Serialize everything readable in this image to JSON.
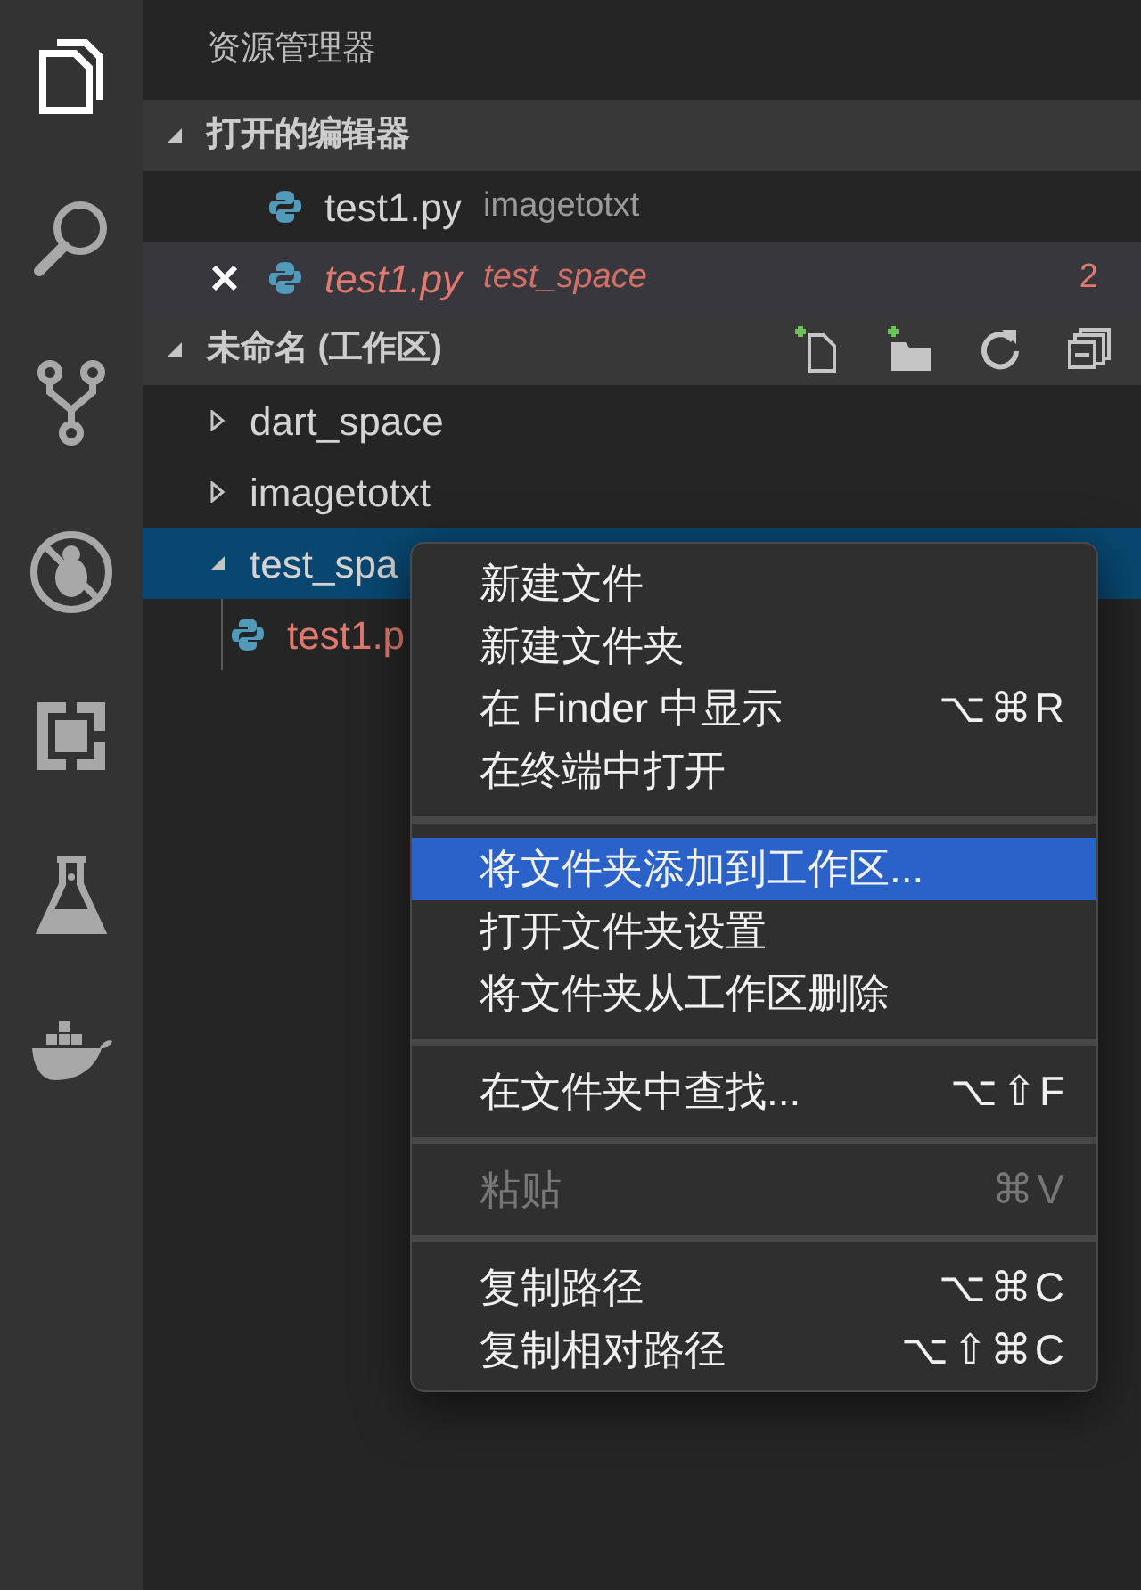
{
  "activity_bar": [
    {
      "kind": "files",
      "selected": true
    },
    {
      "kind": "search",
      "selected": false
    },
    {
      "kind": "scm",
      "selected": false
    },
    {
      "kind": "debug",
      "selected": false
    },
    {
      "kind": "extensions",
      "selected": false
    },
    {
      "kind": "flask",
      "selected": false
    },
    {
      "kind": "docker",
      "selected": false
    }
  ],
  "sidebar": {
    "title": "资源管理器",
    "open_editors": {
      "title": "打开的编辑器",
      "expanded": true,
      "items": [
        {
          "name": "test1.py",
          "folder": "imagetotxt",
          "focused": false,
          "preview": false,
          "has_errors": false
        },
        {
          "name": "test1.py",
          "folder": "test_space",
          "focused": true,
          "preview": true,
          "has_errors": true,
          "problems": "2"
        }
      ]
    },
    "workspace": {
      "title": "未命名 (工作区)",
      "expanded": true,
      "tree": [
        {
          "name": "dart_space",
          "kind": "folder",
          "expanded": false,
          "selected": false
        },
        {
          "name": "imagetotxt",
          "kind": "folder",
          "expanded": false,
          "selected": false
        },
        {
          "name": "test_spa",
          "kind": "folder",
          "expanded": true,
          "selected": true,
          "children": [
            {
              "name": "test1.p",
              "kind": "file",
              "has_errors": true,
              "selected": false
            }
          ]
        }
      ]
    }
  },
  "context_menu": {
    "groups": [
      [
        {
          "label": "新建文件",
          "selected": false,
          "disabled": false
        },
        {
          "label": "新建文件夹",
          "selected": false,
          "disabled": false
        },
        {
          "label": "在 Finder 中显示",
          "shortcut": "⌥⌘R",
          "selected": false,
          "disabled": false
        },
        {
          "label": "在终端中打开",
          "selected": false,
          "disabled": false
        }
      ],
      [
        {
          "label": "将文件夹添加到工作区...",
          "selected": true,
          "disabled": false
        },
        {
          "label": "打开文件夹设置",
          "selected": false,
          "disabled": false
        },
        {
          "label": "将文件夹从工作区删除",
          "selected": false,
          "disabled": false
        }
      ],
      [
        {
          "label": "在文件夹中查找...",
          "shortcut": "⌥⇧F",
          "selected": false,
          "disabled": false
        }
      ],
      [
        {
          "label": "粘贴",
          "shortcut": "⌘V",
          "selected": false,
          "disabled": true
        }
      ],
      [
        {
          "label": "复制路径",
          "shortcut": "⌥⌘C",
          "selected": false,
          "disabled": false
        },
        {
          "label": "复制相对路径",
          "shortcut": "⌥⇧⌘C",
          "selected": false,
          "disabled": false
        }
      ]
    ]
  }
}
